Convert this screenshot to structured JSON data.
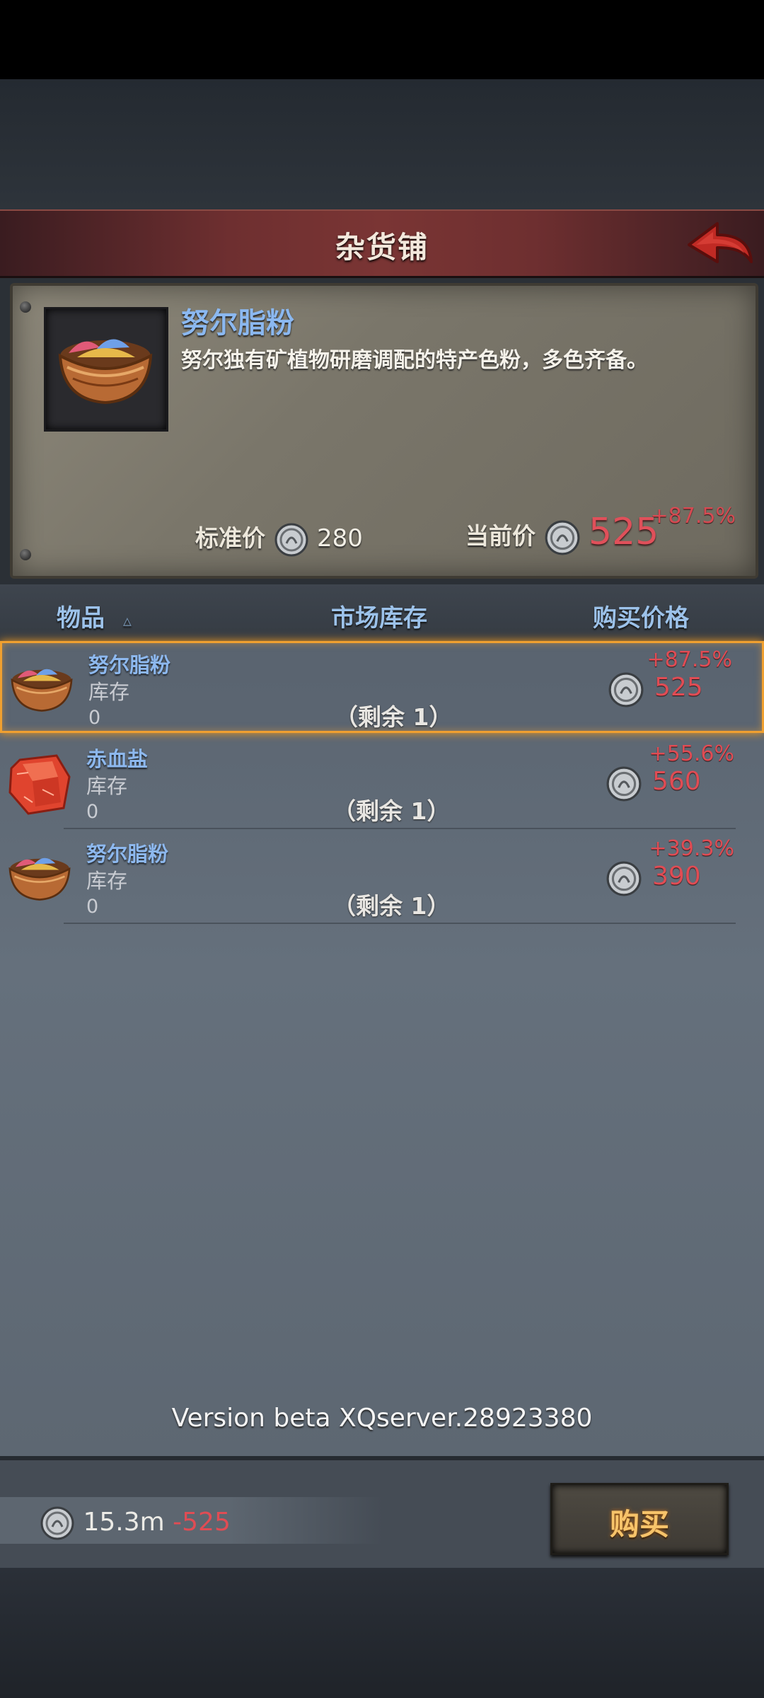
{
  "header": {
    "title": "杂货铺"
  },
  "detail": {
    "name": "努尔脂粉",
    "description": "努尔独有矿植物研磨调配的特产色粉，多色齐备。",
    "standard_price_label": "标准价",
    "standard_price": "280",
    "current_price_label": "当前价",
    "current_price": "525",
    "change_percent": "+87.5%"
  },
  "columns": {
    "item": "物品",
    "sort_indicator": "▵",
    "stock": "市场库存",
    "price": "购买价格"
  },
  "items": [
    {
      "name": "努尔脂粉",
      "stock_label": "库存",
      "stock": "0",
      "remaining": "（剩余 1）",
      "change_percent": "+87.5%",
      "price": "525",
      "icon": "powder-bowl-icon"
    },
    {
      "name": "赤血盐",
      "stock_label": "库存",
      "stock": "0",
      "remaining": "（剩余 1）",
      "change_percent": "+55.6%",
      "price": "560",
      "icon": "red-salt-icon"
    },
    {
      "name": "努尔脂粉",
      "stock_label": "库存",
      "stock": "0",
      "remaining": "（剩余 1）",
      "change_percent": "+39.3%",
      "price": "390",
      "icon": "powder-bowl-icon"
    }
  ],
  "version": "Version beta XQserver.28923380",
  "wallet": {
    "amount": "15.3m",
    "delta": "-525"
  },
  "buy_button": "购买",
  "colors": {
    "accent_red": "#e04c54",
    "name_blue": "#8db8ee",
    "selection": "#f0a030",
    "button_text": "#f6c36a"
  }
}
